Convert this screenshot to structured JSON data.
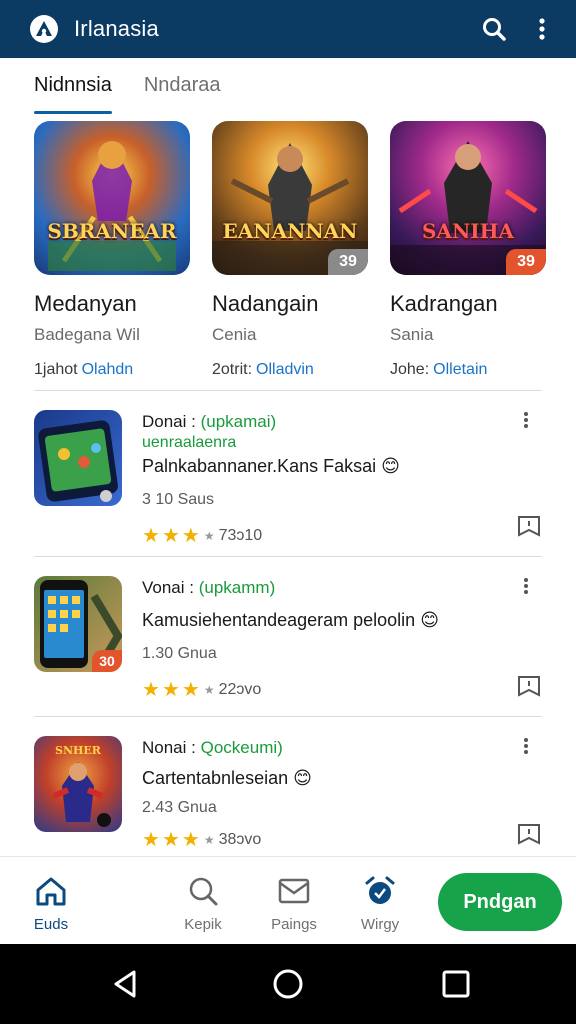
{
  "appbar": {
    "title": "Irlanasia",
    "logo_icon": "app-logo-icon",
    "search_icon": "search-icon",
    "menu_icon": "more-vert-icon"
  },
  "tabs": [
    {
      "label": "Nidnnsia",
      "active": true
    },
    {
      "label": "Nndaraa",
      "active": false
    }
  ],
  "featured": [
    {
      "name": "Medanyan",
      "sub": "Badegana Wil",
      "meta": "1jahot",
      "link": "Olahdn",
      "art_title": "SBRANEAR",
      "badge": "",
      "badge_color": ""
    },
    {
      "name": "Nadangain",
      "sub": "Cenia",
      "meta": "2otrit:",
      "link": "Olladvin",
      "art_title": "EANANNAN",
      "badge": "39",
      "badge_color": "#8a8a8a"
    },
    {
      "name": "Kadrangan",
      "sub": "Sania",
      "meta": "Johe:",
      "link": "Olletain",
      "art_title": "SANIHA",
      "badge": "39",
      "badge_color": "#e2542c"
    }
  ],
  "list": [
    {
      "prefix": "Donai :",
      "tag": "(upkamai)",
      "subgreen": "uenraalaenra",
      "desc": "Palnkabannaner.Kans Faksai 😊",
      "size": "3 10 Saus",
      "rating": "73ɔ10",
      "thumb_badge": ""
    },
    {
      "prefix": "Vonai :",
      "tag": "(upkamm)",
      "subgreen": "",
      "desc": "Kamusiehentandeageram peloolin 😊",
      "size": "1.30 Gnua",
      "rating": "22ɔvo",
      "thumb_badge": "30"
    },
    {
      "prefix": "Nonai :",
      "tag": "Qockeumi)",
      "subgreen": "",
      "desc": "Cartentabnleseian 😊",
      "size": "2.43 Gnua",
      "rating": "38ɔvo",
      "thumb_badge": ""
    }
  ],
  "bottomnav": [
    {
      "label": "Euds",
      "icon": "home-icon",
      "active": true
    },
    {
      "label": "Kepik",
      "icon": "search-icon",
      "active": false
    },
    {
      "label": "Paings",
      "icon": "mail-icon",
      "active": false
    },
    {
      "label": "Wirgy",
      "icon": "alarm-icon",
      "active": false
    }
  ],
  "primary_button": "Pndgan",
  "colors": {
    "appbar": "#0b3a63",
    "accent": "#0b5fa5",
    "green": "#16a34a",
    "star": "#f2b100"
  }
}
